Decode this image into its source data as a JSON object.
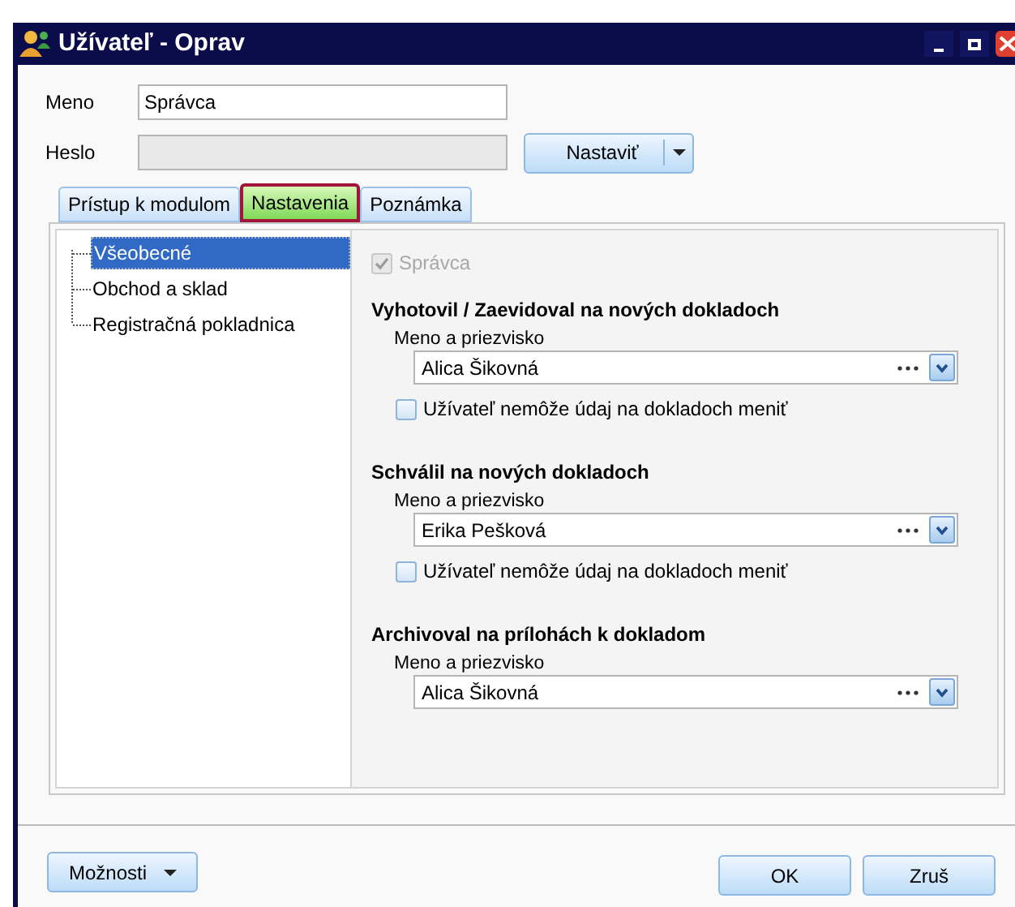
{
  "window": {
    "title": "Užívateľ - Oprav"
  },
  "fields": [
    {
      "label": "Meno",
      "value": "Správca",
      "disabled": false
    },
    {
      "label": "Heslo",
      "disabled": true
    }
  ],
  "set_button": {
    "label": "Nastaviť"
  },
  "tabs": [
    {
      "label": "Prístup k modulom",
      "selected": false
    },
    {
      "label": "Nastavenia",
      "selected": true
    },
    {
      "label": "Poznámka",
      "selected": false
    }
  ],
  "tree": [
    {
      "label": "Všeobecné",
      "selected": true
    },
    {
      "label": "Obchod a sklad",
      "selected": false
    },
    {
      "label": "Registračná pokladnica",
      "selected": false
    }
  ],
  "admin_checkbox": {
    "label": "Správca",
    "checked": true,
    "disabled": true
  },
  "sections": [
    {
      "title": "Vyhotovil / Zaevidoval na nových dokladoch",
      "field_label": "Meno a priezvisko",
      "value": "Alica Šikovná",
      "lock": {
        "label": "Užívateľ nemôže údaj na dokladoch meniť",
        "checked": false
      }
    },
    {
      "title": "Schválil na nových dokladoch",
      "field_label": "Meno a priezvisko",
      "value": "Erika Pešková",
      "lock": {
        "label": "Užívateľ nemôže údaj na dokladoch meniť",
        "checked": false
      }
    },
    {
      "title": "Archivoval na prílohách k dokladom",
      "field_label": "Meno a priezvisko",
      "value": "Alica Šikovná"
    }
  ],
  "buttons": {
    "options": "Možnosti",
    "ok": "OK",
    "cancel": "Zruš"
  }
}
